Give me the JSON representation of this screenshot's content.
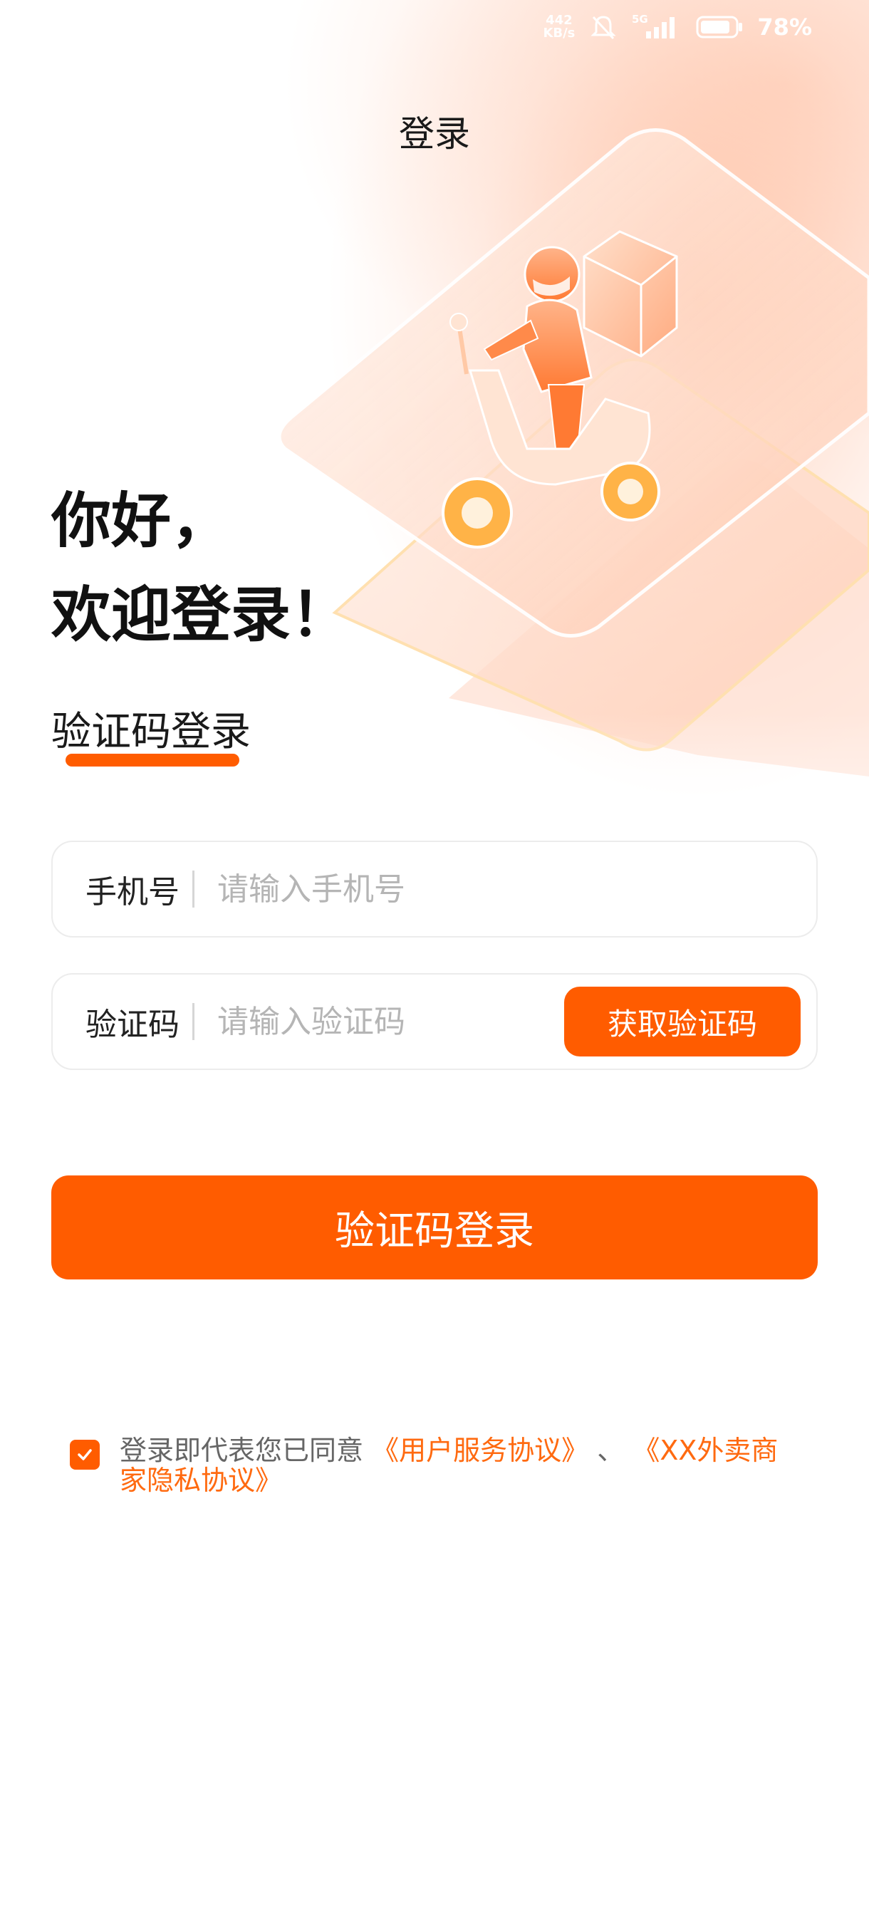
{
  "status_bar": {
    "net_speed_value": "442",
    "net_speed_unit": "KB/s",
    "network_type": "5G",
    "battery_percent": "78%",
    "icons": [
      "mute-bell-icon",
      "signal-icon",
      "battery-icon"
    ]
  },
  "header": {
    "title": "登录"
  },
  "greeting": {
    "line1": "你好，",
    "line2": "欢迎登录！"
  },
  "tab": {
    "label": "验证码登录"
  },
  "phone_field": {
    "label": "手机号",
    "placeholder": "请输入手机号",
    "value": ""
  },
  "code_field": {
    "label": "验证码",
    "placeholder": "请输入验证码",
    "value": "",
    "button_label": "获取验证码"
  },
  "submit": {
    "label": "验证码登录"
  },
  "agreement": {
    "checked": true,
    "prefix": "登录即代表您已同意",
    "link1": "《用户服务协议》",
    "separator": "、",
    "link2": "《XX外卖商家隐私协议》"
  },
  "colors": {
    "accent": "#ff5c00",
    "link": "#ff6a10",
    "text_primary": "#111111",
    "placeholder": "#b5b5b5"
  }
}
